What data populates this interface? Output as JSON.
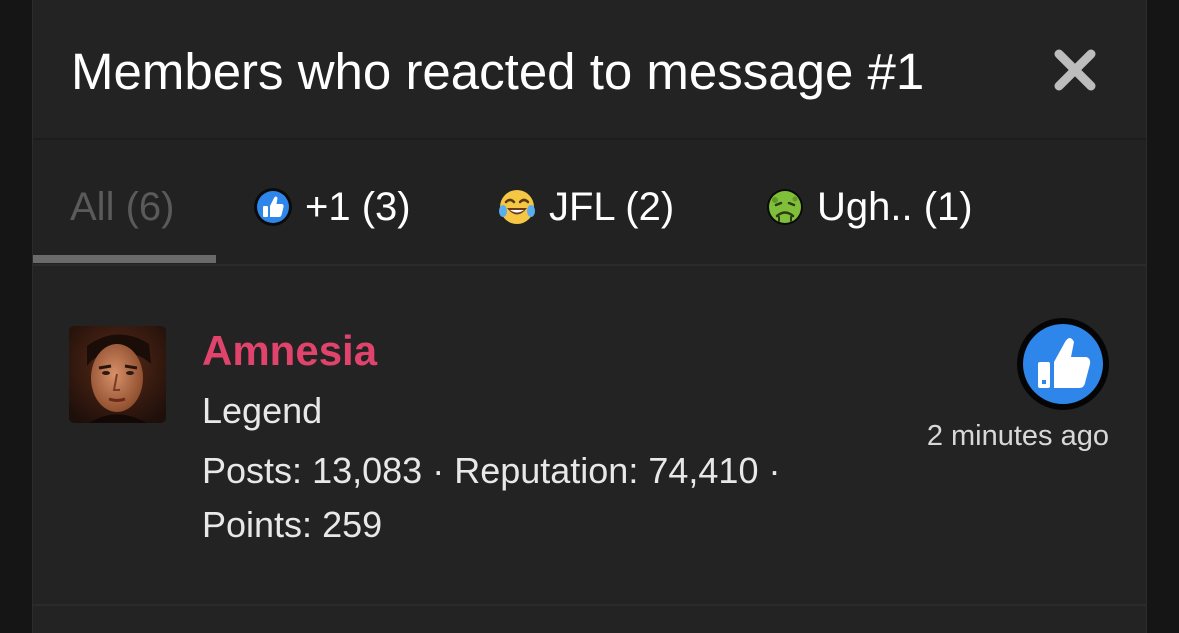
{
  "modal": {
    "title": "Members who reacted to message #1"
  },
  "tabs": [
    {
      "label": "All (6)",
      "icon": "none"
    },
    {
      "label": "+1 (3)",
      "icon": "thumbs-up-icon"
    },
    {
      "label": "JFL (2)",
      "icon": "laughing-crying-icon"
    },
    {
      "label": "Ugh.. (1)",
      "icon": "nauseated-face-icon"
    }
  ],
  "members": [
    {
      "name": "Amnesia",
      "title": "Legend",
      "posts_label": "Posts:",
      "posts": "13,083",
      "reputation_label": "Reputation:",
      "reputation": "74,410",
      "points_label": "Points:",
      "points": "259",
      "reaction": "thumbs-up-icon",
      "time": "2 minutes ago"
    }
  ],
  "colors": {
    "username": "#e0436c",
    "background": "#232323",
    "active_tab_underline": "#6a6a6a",
    "reaction_blue": "#2f86ea"
  }
}
